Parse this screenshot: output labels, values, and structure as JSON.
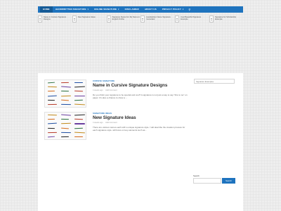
{
  "nav": {
    "items": [
      {
        "label": "HOME",
        "has_dropdown": false
      },
      {
        "label": "HANDWRITTEN SIGNATURE",
        "has_dropdown": true
      },
      {
        "label": "ONLINE SIGNATURE",
        "has_dropdown": true
      },
      {
        "label": "DISCLAIMER",
        "has_dropdown": false
      },
      {
        "label": "ABOUT US",
        "has_dropdown": false
      },
      {
        "label": "PRIVACY POLICY",
        "has_dropdown": false
      }
    ],
    "caret": "▾",
    "search_icon": "⚲",
    "accent_color": "#1e73be"
  },
  "featured": [
    {
      "text": "Name in Cursive Signature Designs"
    },
    {
      "text": "New Signature Ideas"
    },
    {
      "text": "Signature Styles For My Name in English Online"
    },
    {
      "text": "Handwritten Name Signature Generator"
    },
    {
      "text": "Cool Beautiful Signature Example"
    },
    {
      "text": "Signature for Scholarship Example"
    }
  ],
  "posts": [
    {
      "category": "CURSIVE SIGNATURE",
      "title": "Name in Cursive Signature Designs",
      "date": "4 weeks ago",
      "comments": "Add Comment",
      "excerpt": "Do you think your signature to be special and cool? A signature is not just a way to say \"this is me\" on paper. It's also a chance to show a ..."
    },
    {
      "category": "SIGNATURE IDEAS",
      "title": "New Signature Ideas",
      "date": "4 weeks ago",
      "comments": "Add Comment",
      "excerpt": "There are various names each with a unique signature style. I will describe the creation process for each signature style. will focus on key elements such as..."
    }
  ],
  "sidebar": {
    "search_placeholder": "Signature Examples",
    "bottom_search_label": "Search",
    "bottom_search_button": "Search"
  }
}
